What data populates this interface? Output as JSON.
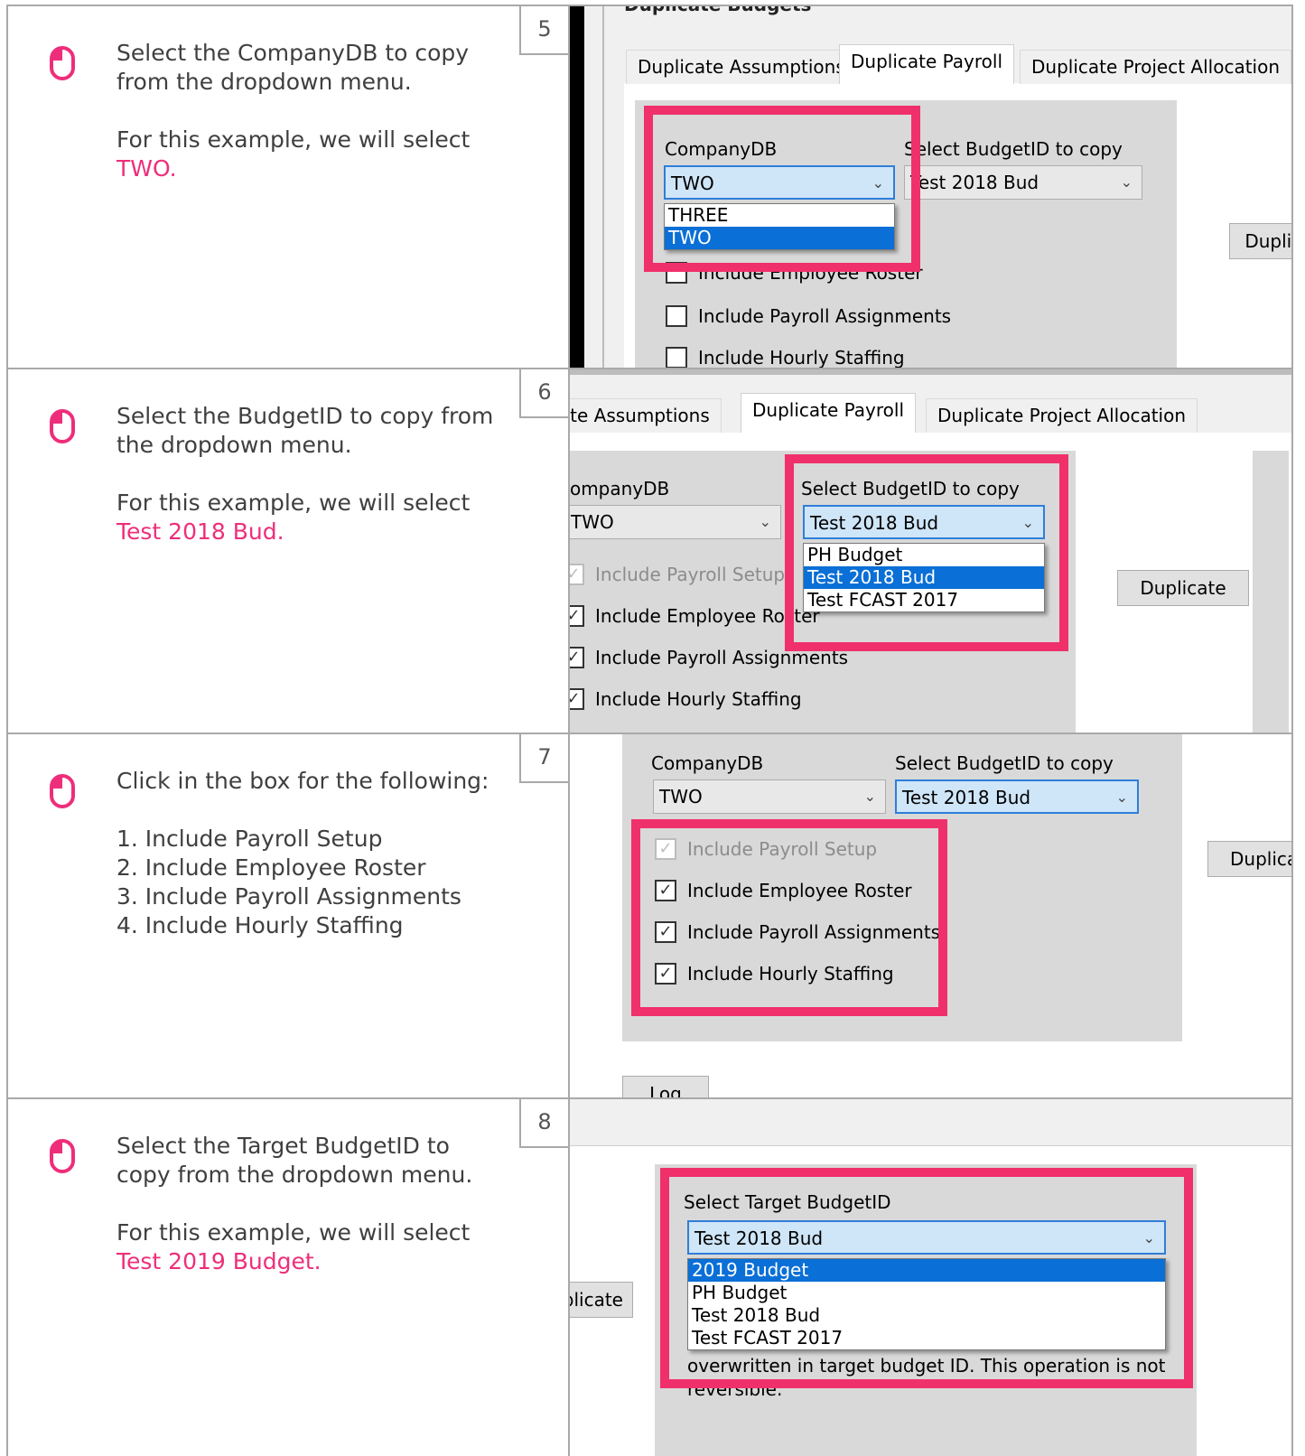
{
  "steps": [
    {
      "number": "5",
      "lines": [
        "Select the CompanyDB to copy from the dropdown menu."
      ],
      "example_prefix": "For this example, we will select",
      "example_value": "TWO.",
      "shot": {
        "title": "Duplicate Budgets",
        "tabs": [
          "Duplicate Assumptions",
          "Duplicate Payroll",
          "Duplicate Project Allocation"
        ],
        "company_label": "CompanyDB",
        "company_value": "TWO",
        "company_options": [
          "THREE",
          "TWO"
        ],
        "budget_label": "Select BudgetID to copy",
        "budget_value": "Test 2018 Bud",
        "duplicate_button": "Duplicate",
        "checkboxes": [
          "Include Employee Roster",
          "Include Payroll Assignments",
          "Include Hourly Staffing"
        ]
      }
    },
    {
      "number": "6",
      "lines": [
        "Select the BudgetID to copy from the dropdown menu."
      ],
      "example_prefix": "For this example, we will select",
      "example_value": "Test 2018 Bud.",
      "shot": {
        "tabs": [
          "Duplicate Assumptions",
          "Duplicate Payroll",
          "Duplicate Project Allocation"
        ],
        "company_label": "CompanyDB",
        "company_value": "TWO",
        "budget_label": "Select BudgetID to copy",
        "budget_value": "Test 2018 Bud",
        "budget_options": [
          "PH Budget",
          "Test 2018 Bud",
          "Test FCAST 2017"
        ],
        "duplicate_button": "Duplicate",
        "checkboxes": [
          "Include Payroll Setup",
          "Include Employee Roster",
          "Include Payroll Assignments",
          "Include Hourly Staffing"
        ]
      }
    },
    {
      "number": "7",
      "intro": "Click in the box for the following:",
      "items": [
        "1. Include Payroll Setup",
        "2. Include Employee Roster",
        "3. Include Payroll Assignments",
        "4. Include Hourly Staffing"
      ],
      "shot": {
        "company_label": "CompanyDB",
        "company_value": "TWO",
        "budget_label": "Select BudgetID to copy",
        "budget_value": "Test 2018 Bud",
        "duplicate_button": "Duplicate",
        "checkboxes": [
          "Include Payroll Setup",
          "Include Employee Roster",
          "Include Payroll Assignments",
          "Include Hourly Staffing"
        ],
        "log_button": "Log"
      }
    },
    {
      "number": "8",
      "lines": [
        "Select the Target BudgetID to copy from the dropdown menu."
      ],
      "example_prefix": "For this example, we will select",
      "example_value": "Test 2019 Budget.",
      "shot": {
        "duplicate_button": "Duplicate",
        "target_label": "Select Target BudgetID",
        "target_value": "Test 2018 Bud",
        "target_options": [
          "2019 Budget",
          "PH Budget",
          "Test 2018 Bud",
          "Test FCAST 2017"
        ],
        "warning": "overwritten in target budget ID. This operation is not reversible."
      }
    }
  ],
  "colors": {
    "accent": "#ee2e7a",
    "highlight": "#f0306b",
    "selection": "#0a6fd6"
  },
  "icons": {
    "step_icon": "mouse-click-icon"
  }
}
